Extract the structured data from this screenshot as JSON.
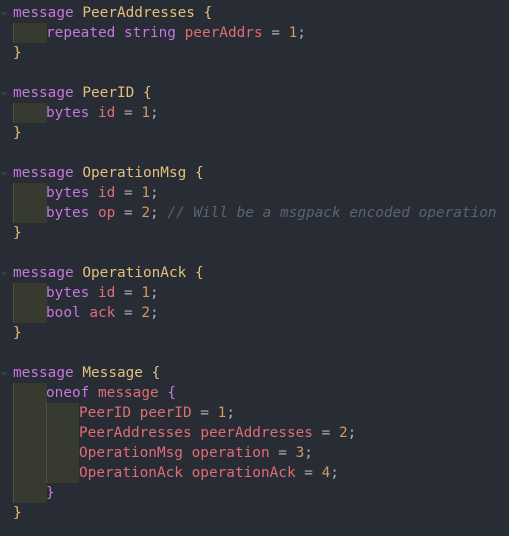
{
  "editor": {
    "lines": [
      {
        "indent": 0,
        "fold": true,
        "tokens": [
          {
            "t": "message",
            "c": "kw"
          },
          {
            "t": " ",
            "c": "op"
          },
          {
            "t": "PeerAddresses",
            "c": "type"
          },
          {
            "t": " ",
            "c": "op"
          },
          {
            "t": "{",
            "c": "brace"
          }
        ]
      },
      {
        "indent": 1,
        "tokens": [
          {
            "t": "repeated",
            "c": "kw"
          },
          {
            "t": " ",
            "c": "op"
          },
          {
            "t": "string",
            "c": "kw"
          },
          {
            "t": " ",
            "c": "op"
          },
          {
            "t": "peerAddrs",
            "c": "fname"
          },
          {
            "t": " = ",
            "c": "op"
          },
          {
            "t": "1",
            "c": "num"
          },
          {
            "t": ";",
            "c": "op"
          }
        ]
      },
      {
        "indent": 0,
        "tokens": [
          {
            "t": "}",
            "c": "brace"
          }
        ]
      },
      {
        "indent": 0,
        "tokens": []
      },
      {
        "indent": 0,
        "fold": true,
        "tokens": [
          {
            "t": "message",
            "c": "kw"
          },
          {
            "t": " ",
            "c": "op"
          },
          {
            "t": "PeerID",
            "c": "type"
          },
          {
            "t": " ",
            "c": "op"
          },
          {
            "t": "{",
            "c": "brace"
          }
        ]
      },
      {
        "indent": 1,
        "tokens": [
          {
            "t": "bytes",
            "c": "kw"
          },
          {
            "t": " ",
            "c": "op"
          },
          {
            "t": "id",
            "c": "fname"
          },
          {
            "t": " = ",
            "c": "op"
          },
          {
            "t": "1",
            "c": "num"
          },
          {
            "t": ";",
            "c": "op"
          }
        ]
      },
      {
        "indent": 0,
        "tokens": [
          {
            "t": "}",
            "c": "brace"
          }
        ]
      },
      {
        "indent": 0,
        "tokens": []
      },
      {
        "indent": 0,
        "fold": true,
        "tokens": [
          {
            "t": "message",
            "c": "kw"
          },
          {
            "t": " ",
            "c": "op"
          },
          {
            "t": "OperationMsg",
            "c": "type"
          },
          {
            "t": " ",
            "c": "op"
          },
          {
            "t": "{",
            "c": "brace"
          }
        ]
      },
      {
        "indent": 1,
        "tokens": [
          {
            "t": "bytes",
            "c": "kw"
          },
          {
            "t": " ",
            "c": "op"
          },
          {
            "t": "id",
            "c": "fname"
          },
          {
            "t": " = ",
            "c": "op"
          },
          {
            "t": "1",
            "c": "num"
          },
          {
            "t": ";",
            "c": "op"
          }
        ]
      },
      {
        "indent": 1,
        "tokens": [
          {
            "t": "bytes",
            "c": "kw"
          },
          {
            "t": " ",
            "c": "op"
          },
          {
            "t": "op",
            "c": "fname"
          },
          {
            "t": " = ",
            "c": "op"
          },
          {
            "t": "2",
            "c": "num"
          },
          {
            "t": "; ",
            "c": "op"
          },
          {
            "t": "// Will be a msgpack encoded operation",
            "c": "comment"
          }
        ]
      },
      {
        "indent": 0,
        "tokens": [
          {
            "t": "}",
            "c": "brace"
          }
        ]
      },
      {
        "indent": 0,
        "tokens": []
      },
      {
        "indent": 0,
        "fold": true,
        "tokens": [
          {
            "t": "message",
            "c": "kw"
          },
          {
            "t": " ",
            "c": "op"
          },
          {
            "t": "OperationAck",
            "c": "type"
          },
          {
            "t": " ",
            "c": "op"
          },
          {
            "t": "{",
            "c": "brace"
          }
        ]
      },
      {
        "indent": 1,
        "tokens": [
          {
            "t": "bytes",
            "c": "kw"
          },
          {
            "t": " ",
            "c": "op"
          },
          {
            "t": "id",
            "c": "fname"
          },
          {
            "t": " = ",
            "c": "op"
          },
          {
            "t": "1",
            "c": "num"
          },
          {
            "t": ";",
            "c": "op"
          }
        ]
      },
      {
        "indent": 1,
        "tokens": [
          {
            "t": "bool",
            "c": "kw"
          },
          {
            "t": " ",
            "c": "op"
          },
          {
            "t": "ack",
            "c": "fname"
          },
          {
            "t": " = ",
            "c": "op"
          },
          {
            "t": "2",
            "c": "num"
          },
          {
            "t": ";",
            "c": "op"
          }
        ]
      },
      {
        "indent": 0,
        "tokens": [
          {
            "t": "}",
            "c": "brace"
          }
        ]
      },
      {
        "indent": 0,
        "tokens": []
      },
      {
        "indent": 0,
        "fold": true,
        "tokens": [
          {
            "t": "message",
            "c": "kw"
          },
          {
            "t": " ",
            "c": "op"
          },
          {
            "t": "Message",
            "c": "type"
          },
          {
            "t": " ",
            "c": "op"
          },
          {
            "t": "{",
            "c": "brace"
          }
        ]
      },
      {
        "indent": 1,
        "fold": true,
        "tokens": [
          {
            "t": "oneof",
            "c": "kw"
          },
          {
            "t": " ",
            "c": "op"
          },
          {
            "t": "message",
            "c": "fname"
          },
          {
            "t": " ",
            "c": "op"
          },
          {
            "t": "{",
            "c": "brace2"
          }
        ]
      },
      {
        "indent": 2,
        "tokens": [
          {
            "t": "PeerID",
            "c": "fname"
          },
          {
            "t": " ",
            "c": "op"
          },
          {
            "t": "peerID",
            "c": "fname"
          },
          {
            "t": " = ",
            "c": "op"
          },
          {
            "t": "1",
            "c": "num"
          },
          {
            "t": ";",
            "c": "op"
          }
        ]
      },
      {
        "indent": 2,
        "tokens": [
          {
            "t": "PeerAddresses",
            "c": "fname"
          },
          {
            "t": " ",
            "c": "op"
          },
          {
            "t": "peerAddresses",
            "c": "fname"
          },
          {
            "t": " = ",
            "c": "op"
          },
          {
            "t": "2",
            "c": "num"
          },
          {
            "t": ";",
            "c": "op"
          }
        ]
      },
      {
        "indent": 2,
        "tokens": [
          {
            "t": "OperationMsg",
            "c": "fname"
          },
          {
            "t": " ",
            "c": "op"
          },
          {
            "t": "operation",
            "c": "fname"
          },
          {
            "t": " = ",
            "c": "op"
          },
          {
            "t": "3",
            "c": "num"
          },
          {
            "t": ";",
            "c": "op"
          }
        ]
      },
      {
        "indent": 2,
        "tokens": [
          {
            "t": "OperationAck",
            "c": "fname"
          },
          {
            "t": " ",
            "c": "op"
          },
          {
            "t": "operationAck",
            "c": "fname"
          },
          {
            "t": " = ",
            "c": "op"
          },
          {
            "t": "4",
            "c": "num"
          },
          {
            "t": ";",
            "c": "op"
          }
        ]
      },
      {
        "indent": 1,
        "tokens": [
          {
            "t": "}",
            "c": "brace2"
          }
        ]
      },
      {
        "indent": 0,
        "tokens": [
          {
            "t": "}",
            "c": "brace"
          }
        ]
      }
    ],
    "fold_glyph": "⌄"
  },
  "colors": {
    "background": "#282c34",
    "keyword": "#c678dd",
    "type": "#e5c07b",
    "field": "#e06c75",
    "number": "#d19a66",
    "comment": "#5c6370",
    "indent_guide": "#363a2f"
  }
}
